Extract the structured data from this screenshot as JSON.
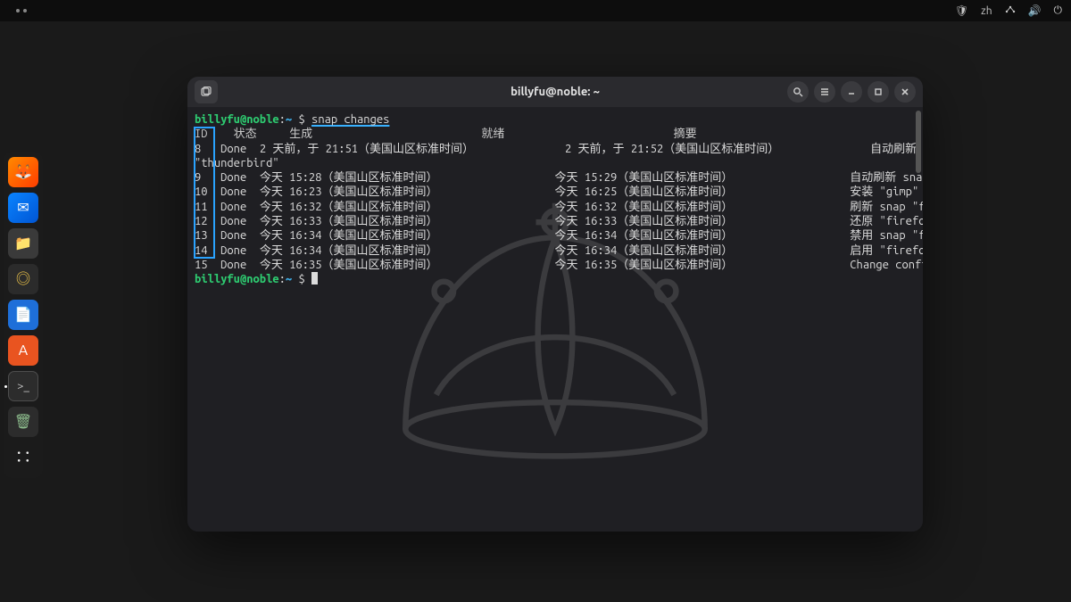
{
  "topbar": {
    "lang": "zh"
  },
  "dock": {
    "items": [
      {
        "name": "firefox",
        "glyph": "🦊"
      },
      {
        "name": "thunderbird",
        "glyph": "✉"
      },
      {
        "name": "files",
        "glyph": "📁"
      },
      {
        "name": "rhythmbox",
        "glyph": "◎"
      },
      {
        "name": "writer",
        "glyph": "📄"
      },
      {
        "name": "software",
        "glyph": "A"
      },
      {
        "name": "terminal",
        "glyph": ">_"
      },
      {
        "name": "trash",
        "glyph": "🗑"
      },
      {
        "name": "apps",
        "glyph": "∷"
      }
    ]
  },
  "window": {
    "title": "billyfu@noble: ~"
  },
  "terminal": {
    "prompt": {
      "user": "billyfu",
      "host": "noble",
      "path": "~",
      "symbol": "$"
    },
    "command": "snap changes",
    "header": {
      "id": "ID",
      "status": "状态",
      "spawn": "生成",
      "ready": "就绪",
      "summary": "摘要"
    },
    "wrap_tail": "\"thunderbird\"",
    "rows": [
      {
        "id": "8",
        "status": "Done",
        "spawn": "2 天前，于 21:51（美国山区标准时间）",
        "ready": "2 天前，于 21:52（美国山区标准时间）",
        "summary": "自动刷新 snap \"snapd-desktop-integration\","
      },
      {
        "id": "9",
        "status": "Done",
        "spawn": "今天 15:28（美国山区标准时间）",
        "ready": "今天 15:29（美国山区标准时间）",
        "summary": "自动刷新 snap \"canonical-livepatch\""
      },
      {
        "id": "10",
        "status": "Done",
        "spawn": "今天 16:23（美国山区标准时间）",
        "ready": "今天 16:25（美国山区标准时间）",
        "summary": "安装 \"gimp\" snap"
      },
      {
        "id": "11",
        "status": "Done",
        "spawn": "今天 16:32（美国山区标准时间）",
        "ready": "今天 16:32（美国山区标准时间）",
        "summary": "刷新 snap \"firefox\""
      },
      {
        "id": "12",
        "status": "Done",
        "spawn": "今天 16:33（美国山区标准时间）",
        "ready": "今天 16:33（美国山区标准时间）",
        "summary": "还原 \"firefox\" snap"
      },
      {
        "id": "13",
        "status": "Done",
        "spawn": "今天 16:34（美国山区标准时间）",
        "ready": "今天 16:34（美国山区标准时间）",
        "summary": "禁用 snap \"firefox\""
      },
      {
        "id": "14",
        "status": "Done",
        "spawn": "今天 16:34（美国山区标准时间）",
        "ready": "今天 16:34（美国山区标准时间）",
        "summary": "启用 \"firefox\" snap"
      },
      {
        "id": "15",
        "status": "Done",
        "spawn": "今天 16:35（美国山区标准时间）",
        "ready": "今天 16:35（美国山区标准时间）",
        "summary": "Change configuration of \"core\" snap"
      }
    ]
  }
}
